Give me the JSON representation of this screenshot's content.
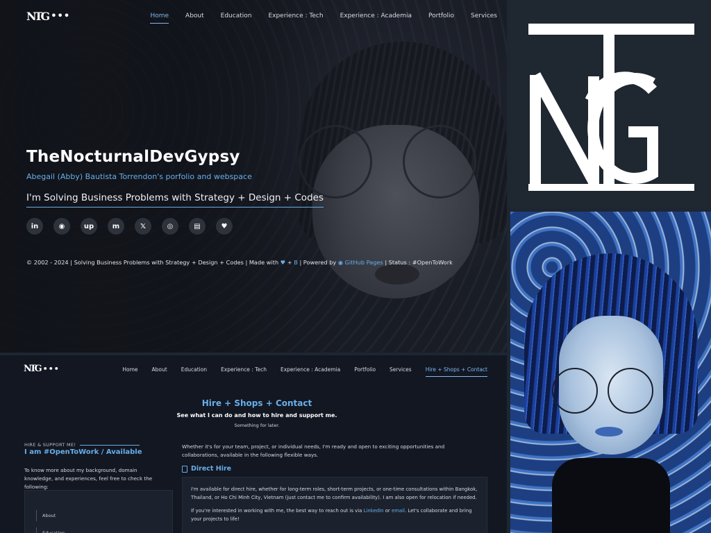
{
  "brand": {
    "monogram": "NTG",
    "dots": "•••"
  },
  "hero": {
    "nav": [
      "Home",
      "About",
      "Education",
      "Experience : Tech",
      "Experience : Academia",
      "Portfolio",
      "Services"
    ],
    "active_nav": "Home",
    "title": "TheNocturnalDevGypsy",
    "subtitle": "Abegail (Abby) Bautista Torrendon's porfolio and webspace",
    "tagline": "I'm Solving Business Problems with Strategy + Design + Codes",
    "socials": [
      {
        "icon": "linkedin-icon",
        "glyph": "in"
      },
      {
        "icon": "github-icon",
        "glyph": "◉"
      },
      {
        "icon": "upwork-icon",
        "glyph": "up"
      },
      {
        "icon": "mastodon-icon",
        "glyph": "m"
      },
      {
        "icon": "x-icon",
        "glyph": "𝕏"
      },
      {
        "icon": "instagram-icon",
        "glyph": "◎"
      },
      {
        "icon": "shop-icon",
        "glyph": "▤"
      },
      {
        "icon": "donate-icon",
        "glyph": "♥"
      }
    ],
    "footer_part1": "© 2002 - 2024 | Solving Business Problems with Strategy + Design + Codes | Made with",
    "footer_heart": "♥",
    "footer_plus": "+",
    "footer_badge": "B",
    "footer_part2": "| Powered by",
    "footer_github": "GitHub Pages",
    "footer_part3": "| Status : #OpenToWork"
  },
  "logo_panel": {
    "letters": "NTG"
  },
  "content": {
    "nav": [
      "Home",
      "About",
      "Education",
      "Experience : Tech",
      "Experience : Academia",
      "Portfolio",
      "Services",
      "Hire + Shops + Contact"
    ],
    "active_nav": "Hire + Shops + Contact",
    "section_title": "Hire + Shops + Contact",
    "section_subtitle": "See what I can do and how to hire and support me.",
    "section_note": "Something for later.",
    "side_eyebrow": "HIRE & SUPPORT ME!",
    "side_heading": "I am #OpenToWork / Available",
    "side_text": "To know more about my background, domain knowledge, and experiences, feel free to check the following:",
    "side_menu": [
      "About",
      "Education"
    ],
    "main_text": "Whether it's for your team, project, or individual needs, I'm ready and open to exciting opportunities and collaborations, available in the following flexible ways.",
    "direct_hire_heading": "Direct Hire",
    "direct_hire_p1": "I'm available for direct hire, whether for long-term roles, short-term projects, or one-time consultations within Bangkok, Thailand, or Ho Chi Minh City, Vietnam (just contact me to confirm availability). I am also open for relocation if needed.",
    "direct_hire_p2a": "If you're interested in working with me, the best way to reach out is via",
    "direct_hire_link1": "LinkedIn",
    "direct_hire_or": "or",
    "direct_hire_link2": "email",
    "direct_hire_p2b": ". Let's collaborate and bring your projects to life!"
  }
}
